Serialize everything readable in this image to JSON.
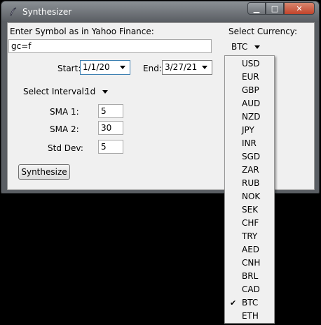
{
  "window": {
    "title": "Synthesizer",
    "minimize_label": "▁",
    "maximize_label": "□",
    "close_label": "✕"
  },
  "symbol": {
    "label": "Enter Symbol as in Yahoo Finance:",
    "value": "gc=f"
  },
  "currency": {
    "label": "Select Currency:",
    "selected": "BTC"
  },
  "dates": {
    "start_label": "Start:",
    "start_value": "1/1/20",
    "end_label": "End:",
    "end_value": "3/27/21"
  },
  "interval": {
    "label": "Select Interval:",
    "selected": "1d"
  },
  "sma1": {
    "label": "SMA 1:",
    "value": "5"
  },
  "sma2": {
    "label": "SMA 2:",
    "value": "30"
  },
  "stddev": {
    "label": "Std Dev:",
    "value": "5"
  },
  "synthesize_label": "Synthesize",
  "currency_options": [
    "USD",
    "EUR",
    "GBP",
    "AUD",
    "NZD",
    "JPY",
    "INR",
    "SGD",
    "ZAR",
    "RUB",
    "NOK",
    "SEK",
    "CHF",
    "TRY",
    "AED",
    "CNH",
    "BRL",
    "CAD",
    "BTC",
    "ETH"
  ],
  "checkmark": "✔"
}
